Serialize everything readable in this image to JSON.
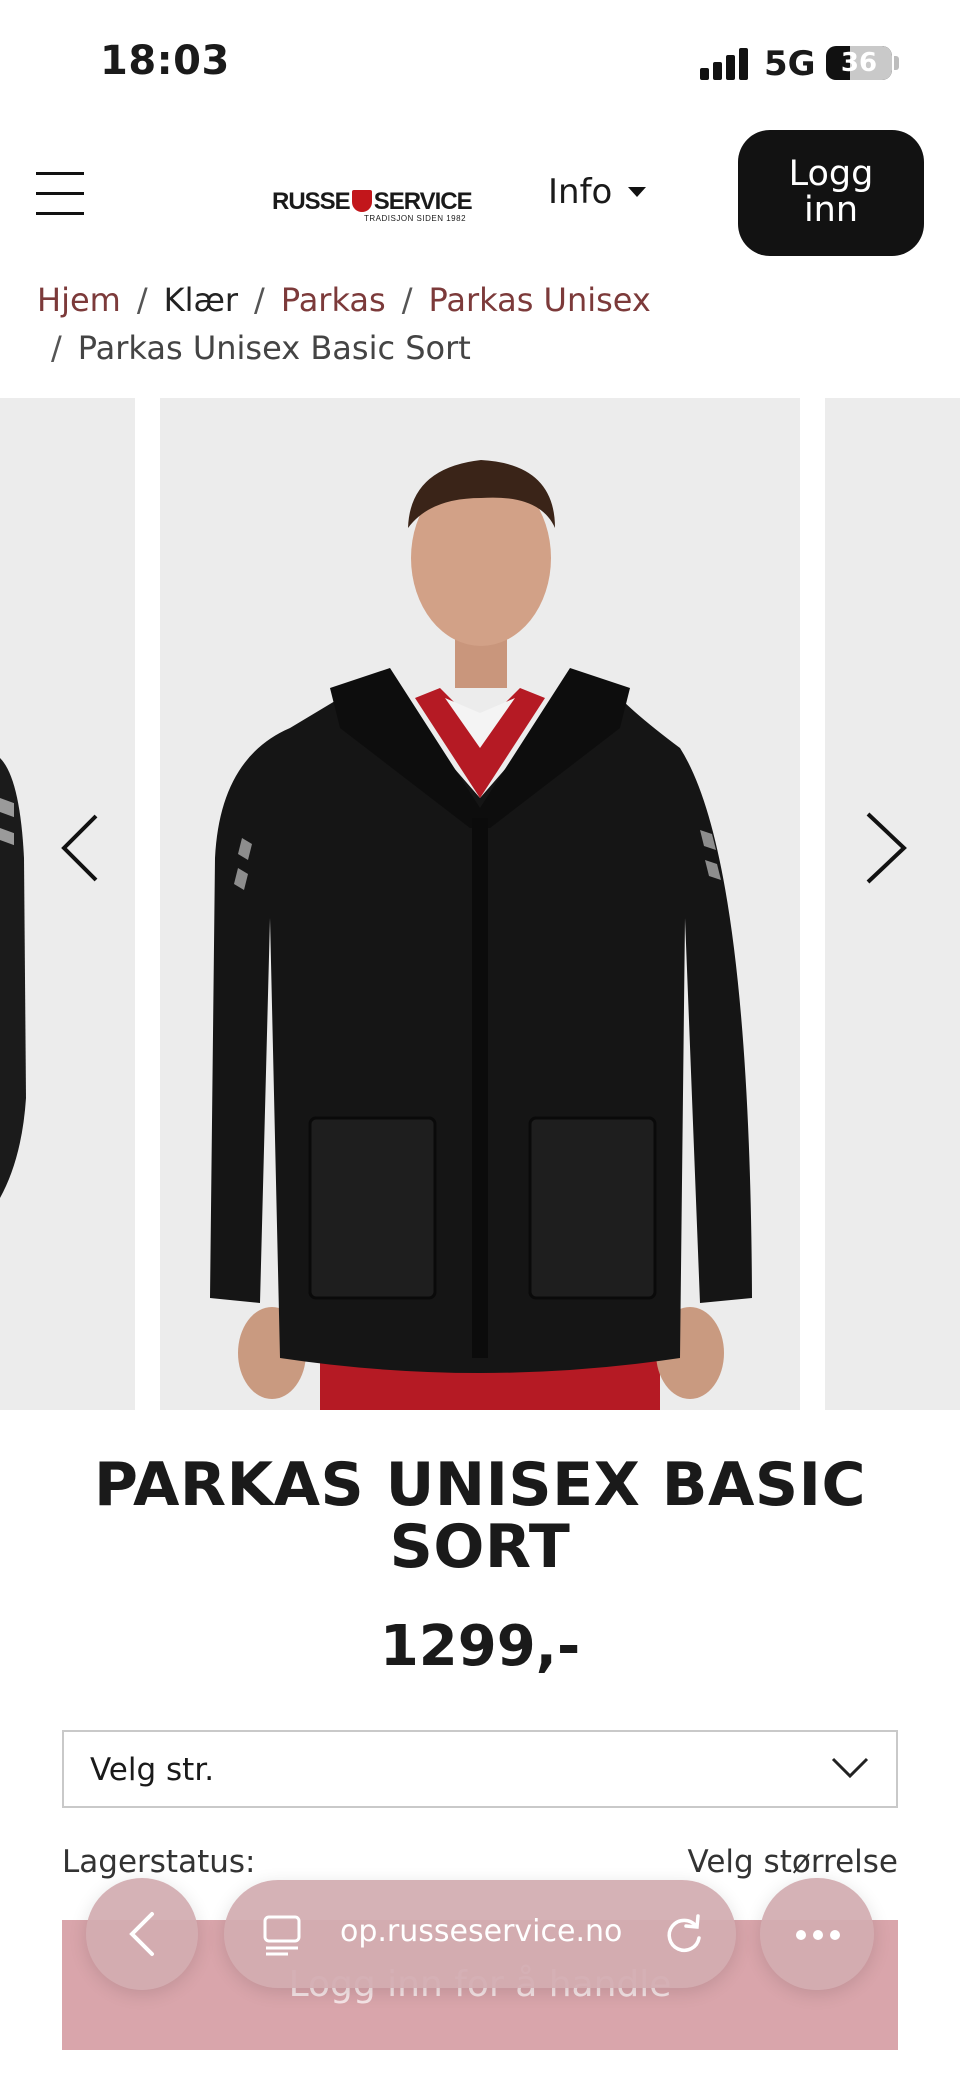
{
  "status_bar": {
    "time": "18:03",
    "network": "5G",
    "battery": "36",
    "battery_level": 0.36
  },
  "header": {
    "logo_text_left": "RUSSE",
    "logo_text_right": "SERVICE",
    "logo_tagline": "TRADISJON SIDEN 1982",
    "info_label": "Info",
    "login_line1": "Logg",
    "login_line2": "inn",
    "menu_icon": "hamburger-icon"
  },
  "breadcrumb": {
    "items": [
      "Hjem",
      "Klær",
      "Parkas",
      "Parkas Unisex",
      "Parkas Unisex Basic Sort"
    ],
    "separator": "/"
  },
  "carousel": {
    "prev_icon": "chevron-left-icon",
    "next_icon": "chevron-right-icon"
  },
  "product": {
    "title_line1": "PARKAS UNISEX BASIC",
    "title_line2": "SORT",
    "price": "1299,-"
  },
  "size_selector": {
    "placeholder": "Velg str.",
    "icon": "chevron-down-icon"
  },
  "stock": {
    "label": "Lagerstatus:",
    "value": "Velg størrelse"
  },
  "buy_button": {
    "label": "Logg inn for å handle"
  },
  "browser": {
    "url": "op.russeservice.no",
    "colors": {
      "pill": "#d2acb0",
      "buy_button": "#d9a5ab",
      "breadcrumb_link": "#7c3a3a"
    }
  }
}
